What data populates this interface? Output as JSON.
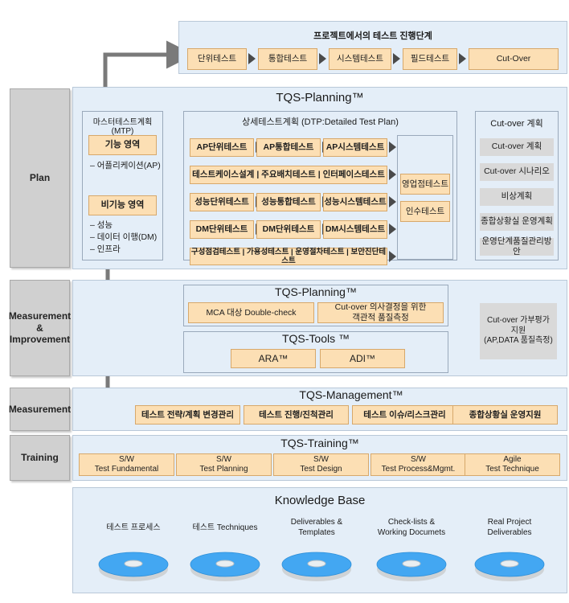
{
  "top_flow": {
    "title": "프로젝트에서의 테스트 진행단계",
    "steps": [
      {
        "label": "단위테스트"
      },
      {
        "label": "통합테스트"
      },
      {
        "label": "시스템테스트"
      },
      {
        "label": "필드테스트"
      },
      {
        "label": "Cut-Over"
      }
    ]
  },
  "rows": {
    "plan": {
      "label": "Plan"
    },
    "measurement_improvement": {
      "label": "Measurement\n&\nImprovement"
    },
    "measurement": {
      "label": "Measurement"
    },
    "training": {
      "label": "Training"
    }
  },
  "plan": {
    "title": "TQS-Planning™",
    "mtp": {
      "title": "마스터테스트계획(MTP)",
      "functional_box": "기능 영역",
      "functional_items": "– 어플리케이션(AP)",
      "nonfunctional_box": "비기능 영역",
      "nonfunctional_items": "– 성능\n– 데이터 이행(DM)\n– 인프라"
    },
    "dtp": {
      "title": "상세테스트계획 (DTP:Detailed Test Plan)",
      "rows": [
        {
          "cells": [
            "AP단위테스트",
            "AP통합테스트",
            "AP시스템테스트"
          ]
        },
        {
          "cells": [
            "테스트케이스설계 | 주요배치테스트 | 인터페이스테스트"
          ]
        },
        {
          "cells": [
            "성능단위테스트",
            "성능통합테스트",
            "성능시스템테스트"
          ]
        },
        {
          "cells": [
            "DM단위테스트",
            "DM단위테스트",
            "DM시스템테스트"
          ]
        },
        {
          "cells": [
            "구성점검테스트 | 가용성테스트 | 운영절차테스트 | 보안진단테스트"
          ]
        }
      ],
      "right_boxes": [
        "영업점테스트",
        "인수테스트"
      ]
    },
    "cutover": {
      "title": "Cut-over 계획",
      "items": [
        "Cut-over 계획",
        "Cut-over 시나리오",
        "비상계획",
        "종합상황실 운영계획",
        "운영단계품질관리방안"
      ]
    }
  },
  "measurement_improvement": {
    "planning": {
      "title": "TQS-Planning™",
      "boxes": [
        "MCA 대상 Double-check",
        "Cut-over 의사결정을 위한\n객관적 품질측정"
      ]
    },
    "tools": {
      "title": "TQS-Tools ™",
      "boxes": [
        "ARA™",
        "ADI™"
      ]
    },
    "outcome": "Cut-over 가부평가\n지원\n(AP,DATA 품질측정)"
  },
  "management": {
    "title": "TQS-Management™",
    "boxes": [
      "테스트 전략/계획 변경관리",
      "테스트 진행/진척관리",
      "테스트 이슈/리스크관리",
      "종합상황실 운영지원"
    ]
  },
  "training": {
    "title": "TQS-Training™",
    "boxes": [
      "S/W\nTest Fundamental",
      "S/W\nTest Planning",
      "S/W\nTest Design",
      "S/W\nTest Process&Mgmt.",
      "Agile\nTest Technique"
    ]
  },
  "knowledge_base": {
    "title": "Knowledge Base",
    "items": [
      {
        "label": "테스트 프로세스",
        "icon": "disc-icon"
      },
      {
        "label": "테스트 Techniques",
        "icon": "disc-icon"
      },
      {
        "label": "Deliverables &\nTemplates",
        "icon": "disc-icon"
      },
      {
        "label": "Check-lists &\nWorking Documets",
        "icon": "disc-icon"
      },
      {
        "label": "Real Project\nDeliverables",
        "icon": "disc-icon"
      }
    ]
  },
  "colors": {
    "panel_bg": "#e4eef8",
    "orange": "#fcdfb4",
    "orange_border": "#d7a86b",
    "gray_label": "#d0d0d0",
    "gray_box": "#d9d9d9",
    "arrow": "#777777",
    "disc": "#3ba1ef"
  }
}
